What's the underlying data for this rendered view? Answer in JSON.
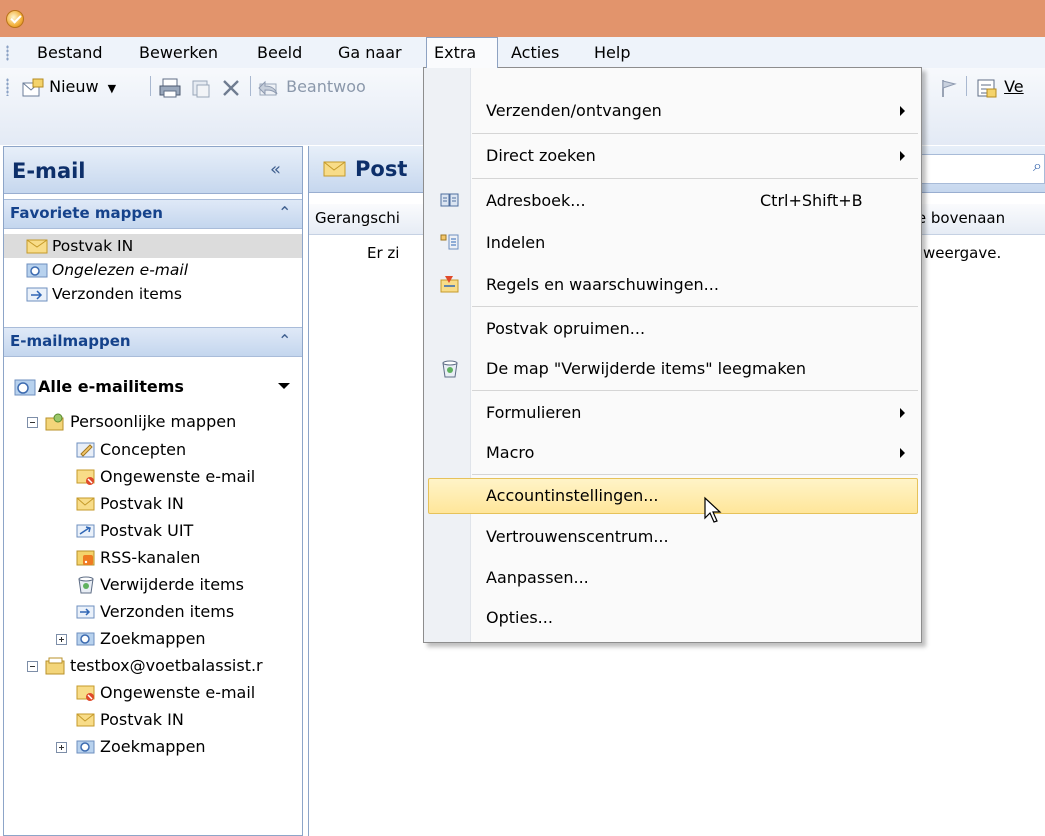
{
  "menubar": {
    "items": [
      {
        "label": "Bestand"
      },
      {
        "label": "Bewerken"
      },
      {
        "label": "Beeld"
      },
      {
        "label": "Ga naar"
      },
      {
        "label": "Extra"
      },
      {
        "label": "Acties"
      },
      {
        "label": "Help"
      }
    ]
  },
  "toolbar": {
    "new_label": "Nieuw",
    "reply_label": "Beantwoo",
    "right_label": "Ve"
  },
  "nav": {
    "title": "E-mail",
    "collapse": "«",
    "favorites_header": "Favoriete mappen",
    "favorites": [
      {
        "label": "Postvak IN"
      },
      {
        "label": "Ongelezen e-mail"
      },
      {
        "label": "Verzonden items"
      }
    ],
    "mailfolders_header": "E-mailmappen",
    "all_items": "Alle e-mailitems",
    "tree": [
      {
        "label": "Persoonlijke mappen"
      },
      {
        "label": "Concepten"
      },
      {
        "label": "Ongewenste e-mail"
      },
      {
        "label": "Postvak IN"
      },
      {
        "label": "Postvak UIT"
      },
      {
        "label": "RSS-kanalen"
      },
      {
        "label": "Verwijderde items"
      },
      {
        "label": "Verzonden items"
      },
      {
        "label": "Zoekmappen"
      },
      {
        "label": "testbox@voetbalassist.r"
      },
      {
        "label": "Ongewenste e-mail"
      },
      {
        "label": "Postvak IN"
      },
      {
        "label": "Zoekmappen"
      }
    ]
  },
  "content": {
    "title": "Post",
    "sort_label": "Gerangschi",
    "sort_right": "te bovenaan",
    "empty_left": "Er zi",
    "empty_right": "e weergave."
  },
  "dropdown": {
    "items": [
      {
        "label": "Verzenden/ontvangen"
      },
      {
        "label": "Direct zoeken"
      },
      {
        "label": "Adresboek...",
        "shortcut": "Ctrl+Shift+B"
      },
      {
        "label": "Indelen"
      },
      {
        "label": "Regels en waarschuwingen..."
      },
      {
        "label": "Postvak opruimen..."
      },
      {
        "label": "De map \"Verwijderde items\" leegmaken"
      },
      {
        "label": "Formulieren"
      },
      {
        "label": "Macro"
      },
      {
        "label": "Accountinstellingen..."
      },
      {
        "label": "Vertrouwenscentrum..."
      },
      {
        "label": "Aanpassen..."
      },
      {
        "label": "Opties..."
      }
    ]
  },
  "colors": {
    "titlebar": "#e2946c",
    "nav_title": "#0d2f6a",
    "hover": "#ffe69a"
  }
}
